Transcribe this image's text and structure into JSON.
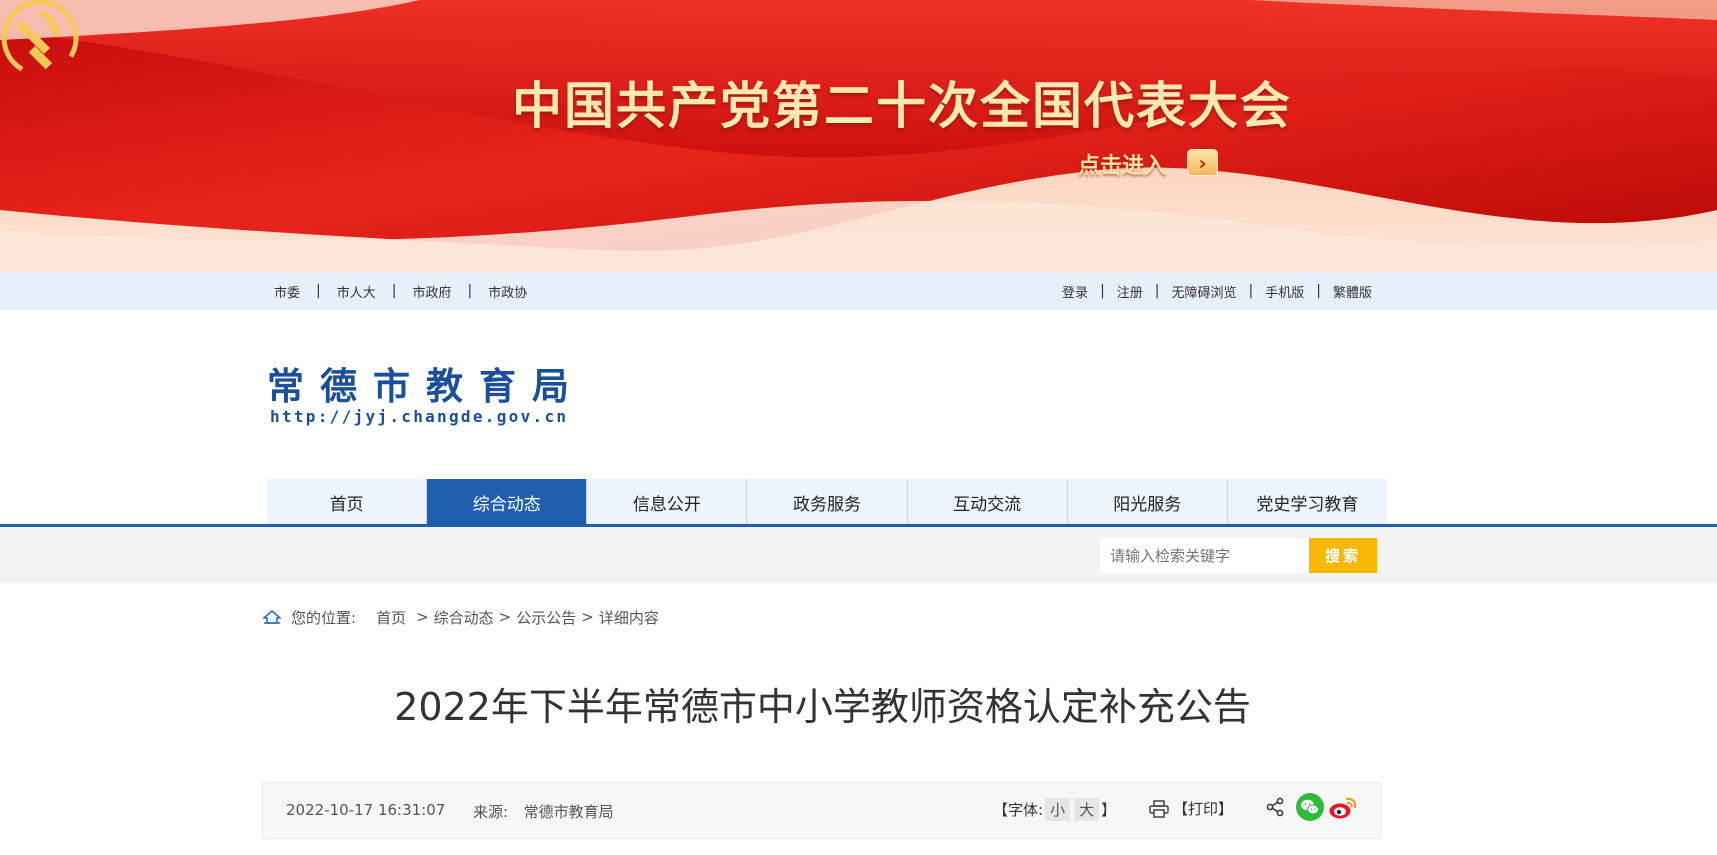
{
  "banner": {
    "title": "中国共产党第二十次全国代表大会",
    "enter_label": "点击进入",
    "enter_arrow": "›"
  },
  "top_links": {
    "left": [
      "市委",
      "市人大",
      "市政府",
      "市政协"
    ],
    "right": [
      "登录",
      "注册",
      "无障碍浏览",
      "手机版",
      "繁體版"
    ],
    "separator": "|"
  },
  "logo": {
    "name": "常德市教育局",
    "url": "http://jyj.changde.gov.cn"
  },
  "nav": {
    "items": [
      "首页",
      "综合动态",
      "信息公开",
      "政务服务",
      "互动交流",
      "阳光服务",
      "党史学习教育"
    ],
    "active_index": 1
  },
  "search": {
    "placeholder": "请输入检索关键字",
    "button": "搜索"
  },
  "breadcrumb": {
    "prefix": "您的位置:",
    "items": [
      "首页",
      "综合动态",
      "公示公告",
      "详细内容"
    ],
    "separator": ">"
  },
  "article": {
    "title": "2022年下半年常德市中小学教师资格认定补充公告",
    "date": "2022-10-17 16:31:07",
    "source_label": "来源:",
    "source": "常德市教育局",
    "font_label_open": "【字体:",
    "font_small": "小",
    "font_large": "大",
    "font_label_close": "】",
    "print_label": "【打印】"
  },
  "colors": {
    "nav_active": "#1f5fad",
    "search_button": "#f6b800",
    "banner_red": "#d8120f",
    "logo_blue": "#1b4f9a"
  }
}
